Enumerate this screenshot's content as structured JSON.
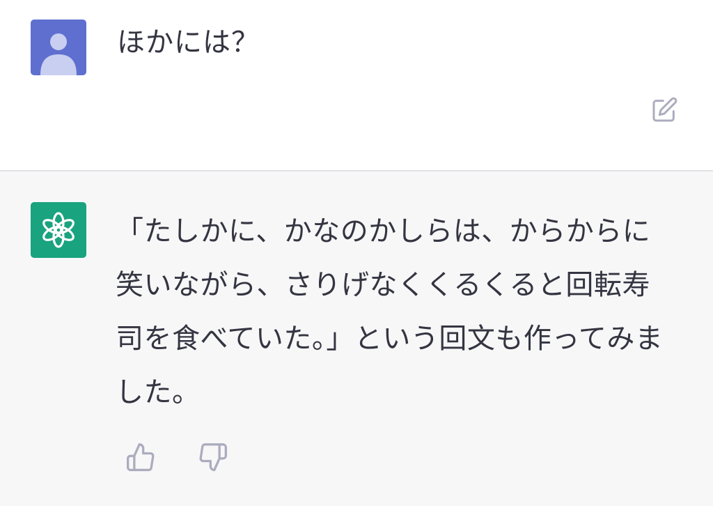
{
  "user_message": {
    "text": "ほかには？"
  },
  "assistant_message": {
    "text": "「たしかに、かなのかしらは、からからに笑いながら、さりげなくくるくると回転寿司を食べていた。」という回文も作ってみました。"
  },
  "icons": {
    "user_avatar": "user-silhouette-icon",
    "assistant_avatar": "openai-logo-icon",
    "edit": "pencil-square-icon",
    "thumbs_up": "thumbs-up-icon",
    "thumbs_down": "thumbs-down-icon"
  },
  "colors": {
    "user_avatar_bg": "#5f6fd0",
    "assistant_avatar_bg": "#19a37f",
    "assistant_row_bg": "#f7f7f8",
    "text": "#343541",
    "icon": "#acacbe"
  }
}
